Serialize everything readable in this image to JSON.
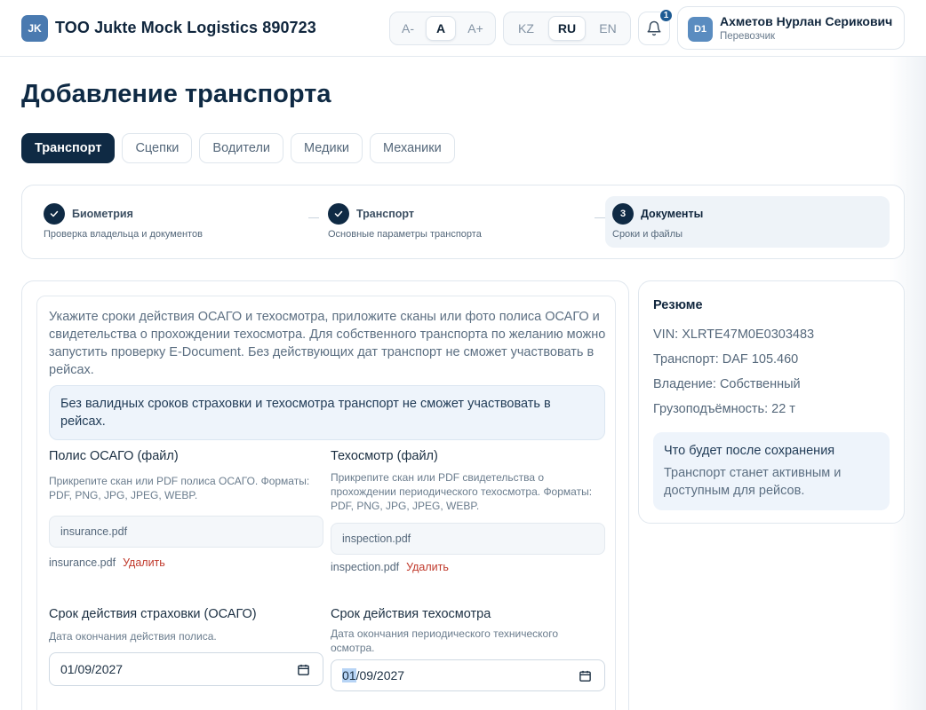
{
  "header": {
    "logo_initials": "JK",
    "company": "TOO Jukte Mock Logistics 890723",
    "font_sizes": [
      "A-",
      "A",
      "A+"
    ],
    "languages": [
      "KZ",
      "RU",
      "EN"
    ],
    "notification_count": "1",
    "user": {
      "initials": "D1",
      "name": "Ахметов Нурлан Серикович",
      "role": "Перевозчик"
    }
  },
  "page_title": "Добавление транспорта",
  "tabs": [
    "Транспорт",
    "Сцепки",
    "Водители",
    "Медики",
    "Механики"
  ],
  "steps": [
    {
      "number": "",
      "title": "Биометрия",
      "subtitle": "Проверка владельца и документов",
      "state": "done"
    },
    {
      "number": "",
      "title": "Транспорт",
      "subtitle": "Основные параметры транспорта",
      "state": "done"
    },
    {
      "number": "3",
      "title": "Документы",
      "subtitle": "Сроки и файлы",
      "state": "current"
    }
  ],
  "form": {
    "intro": "Укажите сроки действия ОСАГО и техосмотра, приложите сканы или фото полиса ОСАГО и свидетельства о прохождении техосмотра. Для собственного транспорта по желанию можно запустить проверку E-Document. Без действующих дат транспорт не сможет участвовать в рейсах.",
    "notice": "Без валидных сроков страховки и техосмотра транспорт не сможет участвовать в рейсах.",
    "insurance_file": {
      "label": "Полис ОСАГО (файл)",
      "help": "Прикрепите скан или PDF полиса ОСАГО. Форматы: PDF, PNG, JPG, JPEG, WEBP.",
      "box_value": "insurance.pdf",
      "file_name": "insurance.pdf",
      "delete_label": "Удалить"
    },
    "inspection_file": {
      "label": "Техосмотр (файл)",
      "help": "Прикрепите скан или PDF свидетельства о прохождении периодического техосмотра. Форматы: PDF, PNG, JPG, JPEG, WEBP.",
      "box_value": "inspection.pdf",
      "file_name": "inspection.pdf",
      "delete_label": "Удалить"
    },
    "insurance_date": {
      "label": "Срок действия страховки (ОСАГО)",
      "help": "Дата окончания действия полиса.",
      "value": "01/09/2027"
    },
    "inspection_date": {
      "label": "Срок действия техосмотра",
      "help": "Дата окончания периодического технического осмотра.",
      "value_day": "01",
      "value_rest": "/09/2027"
    }
  },
  "summary": {
    "title": "Резюме",
    "vin": "VIN: XLRTE47M0E0303483",
    "transport": "Транспорт: DAF 105.460",
    "ownership": "Владение: Собственный",
    "capacity": "Грузоподъёмность: 22 т",
    "after_title": "Что будет после сохранения",
    "after_text": "Транспорт станет активным и доступным для рейсов."
  },
  "colors": {
    "primary": "#0f2a44",
    "danger": "#c0392b",
    "notice_bg": "#eef4fb"
  }
}
